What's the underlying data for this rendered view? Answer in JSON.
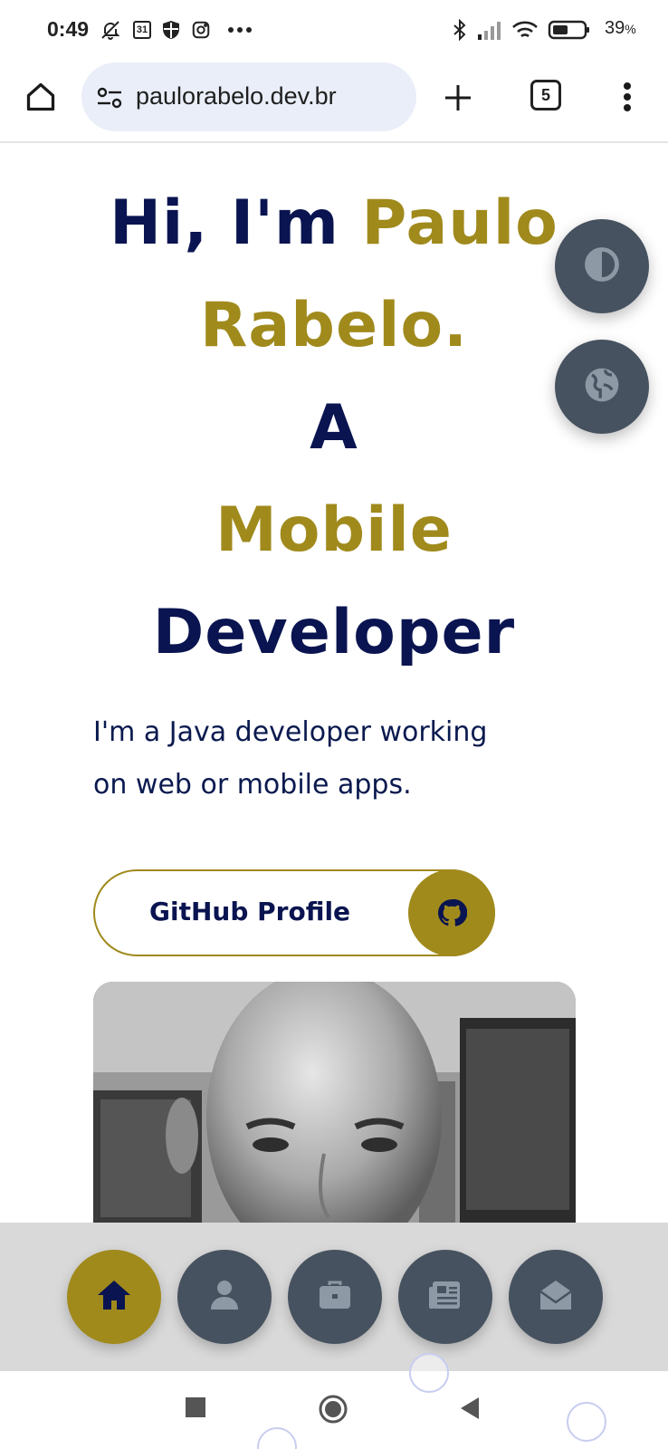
{
  "status_bar": {
    "time": "0:49",
    "battery_percent": "39",
    "battery_suffix": "%",
    "calendar_day": "31",
    "icons": [
      "mute-icon",
      "calendar-icon",
      "shield-icon",
      "instagram-icon",
      "more-dots-icon",
      "bluetooth-icon",
      "signal-icon",
      "wifi-icon",
      "battery-icon"
    ]
  },
  "browser": {
    "url": "paulorabelo.dev.br",
    "tab_count": "5",
    "icons": [
      "home-icon",
      "site-settings-icon",
      "new-tab-icon",
      "tabs-icon",
      "menu-icon"
    ]
  },
  "hero": {
    "greeting": "Hi, I'm",
    "name_first": "Paulo",
    "name_last": "Rabelo.",
    "article": "A",
    "role_1": "Mobile",
    "role_2": "Developer"
  },
  "intro": {
    "line_1": "I'm a Java developer working",
    "line_2": "on web or mobile apps."
  },
  "github_button": {
    "label": "GitHub Profile",
    "icon": "github-icon"
  },
  "floating_buttons": [
    {
      "name": "theme-toggle",
      "icon": "contrast-icon"
    },
    {
      "name": "language-toggle",
      "icon": "globe-icon"
    }
  ],
  "bottom_nav": [
    {
      "name": "home",
      "icon": "home-icon",
      "active": true
    },
    {
      "name": "about",
      "icon": "user-icon",
      "active": false
    },
    {
      "name": "portfolio",
      "icon": "briefcase-icon",
      "active": false
    },
    {
      "name": "blog",
      "icon": "newspaper-icon",
      "active": false
    },
    {
      "name": "contact",
      "icon": "envelope-open-icon",
      "active": false
    }
  ],
  "colors": {
    "navy": "#0a1450",
    "gold": "#a08a1c",
    "slate": "#475260",
    "nav_background": "#d9d9d9"
  }
}
